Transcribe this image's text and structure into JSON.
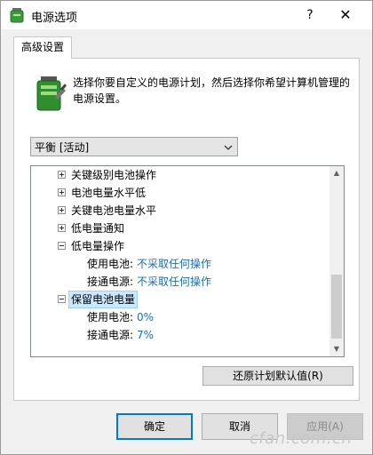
{
  "window": {
    "title": "电源选项",
    "help_label": "?",
    "close_label": "✕"
  },
  "tab": {
    "label": "高级设置"
  },
  "description": "选择你要自定义的电源计划，然后选择你希望计算机管理的电源设置。",
  "plan_select": {
    "value": "平衡 [活动]"
  },
  "tree": {
    "items": [
      {
        "label": "关键级别电池操作",
        "expander": "plus"
      },
      {
        "label": "电池电量水平低",
        "expander": "plus"
      },
      {
        "label": "关键电池电量水平",
        "expander": "plus"
      },
      {
        "label": "低电量通知",
        "expander": "plus"
      },
      {
        "label": "低电量操作",
        "expander": "minus"
      },
      {
        "sub_label": "使用电池:",
        "value": "不采取任何操作"
      },
      {
        "sub_label": "接通电源:",
        "value": "不采取任何操作"
      },
      {
        "label": "保留电池电量",
        "expander": "minus",
        "selected": true
      },
      {
        "sub_label": "使用电池:",
        "value": "0%"
      },
      {
        "sub_label": "接通电源:",
        "value": "7%"
      }
    ]
  },
  "buttons": {
    "restore": "还原计划默认值(R)",
    "ok": "确定",
    "cancel": "取消",
    "apply": "应用(A)"
  },
  "watermark": "cfan.com.cn",
  "colors": {
    "value_blue": "#1a6fb5",
    "selection": "#cce8ff",
    "accent": "#0078d7"
  }
}
